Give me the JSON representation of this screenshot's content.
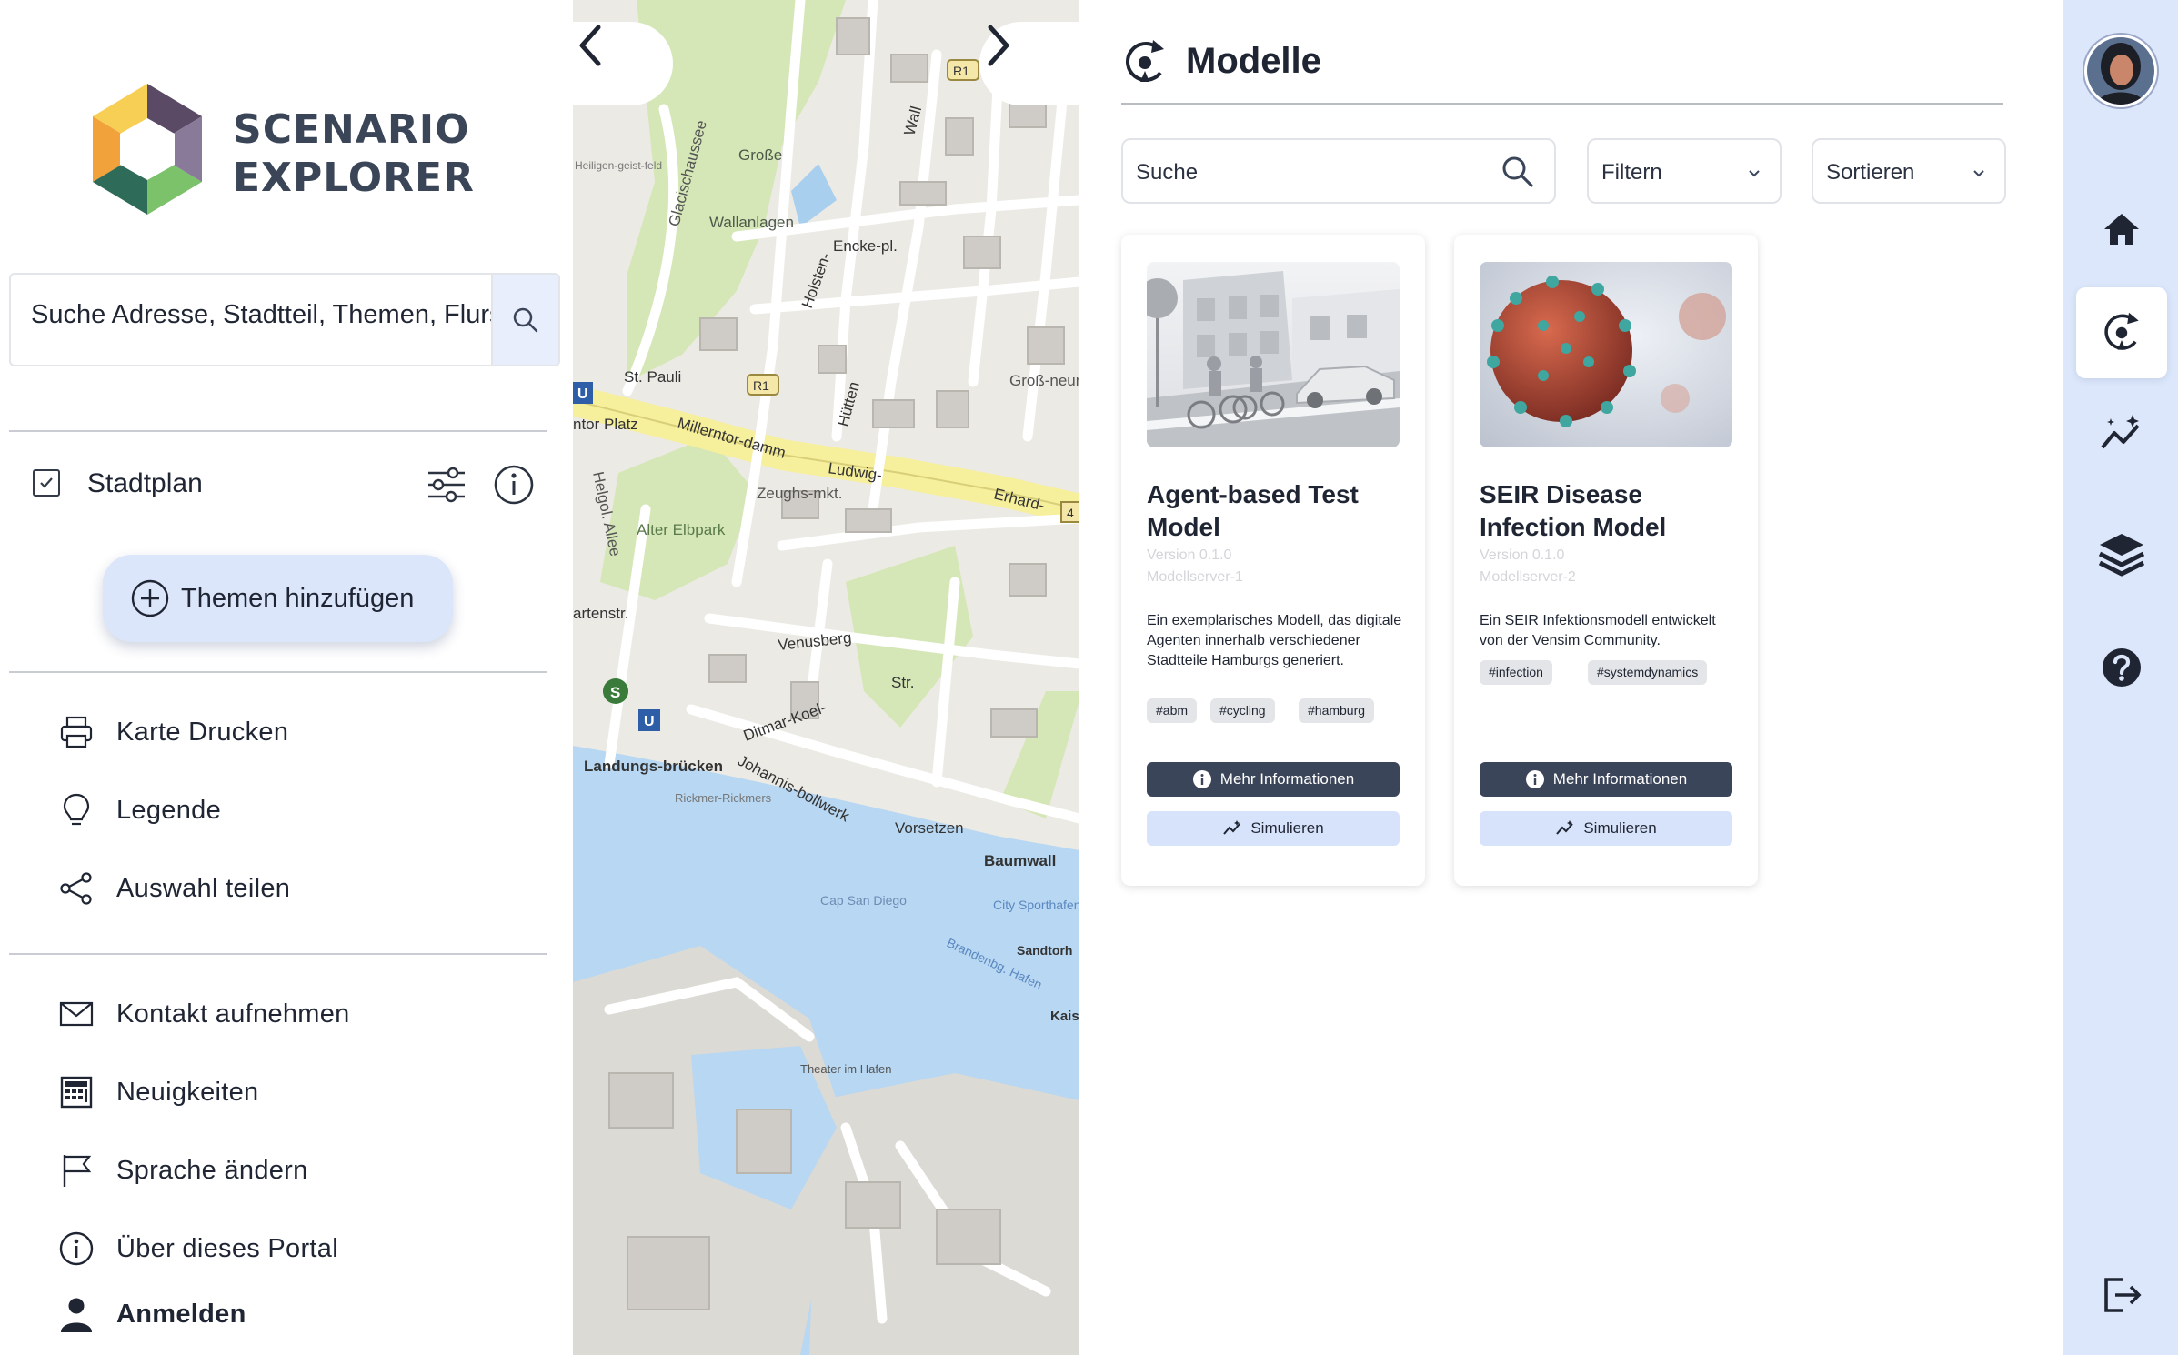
{
  "sidebar": {
    "logo_line1": "SCENARIO",
    "logo_line2": "EXPLORER",
    "search_value": "Suche Adresse, Stadtteil, Themen, Flurs",
    "layer": {
      "label": "Stadtplan",
      "checked": true
    },
    "add_topics_label": "Themen hinzufügen",
    "actions": [
      {
        "label": "Karte Drucken",
        "icon": "printer-icon"
      },
      {
        "label": "Legende",
        "icon": "lightbulb-icon"
      },
      {
        "label": "Auswahl teilen",
        "icon": "share-icon"
      }
    ],
    "links": [
      {
        "label": "Kontakt aufnehmen",
        "icon": "envelope-icon"
      },
      {
        "label": "Neuigkeiten",
        "icon": "newspaper-icon"
      },
      {
        "label": "Sprache ändern",
        "icon": "flag-icon"
      },
      {
        "label": "Über dieses Portal",
        "icon": "info-icon"
      },
      {
        "label": "Anmelden",
        "icon": "user-icon"
      }
    ]
  },
  "map": {
    "labels": [
      "Große",
      "Wallanlagen",
      "Glacischaussee",
      "Heiligen-geist-feld",
      "St. Pauli",
      "Millerntor-damm",
      "Ludwig-",
      "Erhard-",
      "Zeughs-mkt.",
      "Alter Elbpark",
      "Helgol. Allee",
      "Venusberg",
      "Landungs-brücken",
      "Ditmar-Koel-",
      "Johannis-bollwerk",
      "Vorsetzen",
      "Baumwall",
      "Groß-neumarkt",
      "Holsten-",
      "Hütten",
      "Encke-pl.",
      "Rickmer-Rickmers",
      "Cap San Diego",
      "Sandtorh",
      "Theater im Hafen",
      "City Sporthafen",
      "Brandenbg. Hafen",
      "Kais",
      "ntor Platz",
      "artenstr.",
      "Str.",
      "Wall",
      "R1",
      "U",
      "S",
      "4"
    ]
  },
  "main": {
    "title": "Modelle",
    "search_placeholder": "Suche",
    "filter_label": "Filtern",
    "sort_label": "Sortieren",
    "cards": [
      {
        "title": "Agent-based Test Model",
        "version": "Version 0.1.0",
        "server": "Modellserver-1",
        "description": "Ein exemplarisches Modell, das digitale Agenten innerhalb verschiedener Stadtteile Hamburgs generiert.",
        "tags": [
          "#abm",
          "#cycling",
          "#hamburg"
        ],
        "info_label": "Mehr Informationen",
        "simulate_label": "Simulieren",
        "image": "cyclists-street-image"
      },
      {
        "title": "SEIR Disease Infection Model",
        "version": "Version 0.1.0",
        "server": "Modellserver-2",
        "description": "Ein SEIR Infektionsmodell entwickelt von der Vensim Community.",
        "tags": [
          "#infection",
          "#systemdynamics"
        ],
        "info_label": "Mehr Informationen",
        "simulate_label": "Simulieren",
        "image": "virus-image"
      }
    ]
  },
  "rail": {
    "items": [
      "home-icon",
      "models-icon",
      "analysis-icon",
      "layers-icon",
      "help-icon",
      "logout-icon"
    ],
    "active": "models-icon"
  },
  "colors": {
    "accent_light": "#dce7fb",
    "button_dark": "#3b4559",
    "button_light": "#d7e3fa",
    "text": "#1f2533"
  }
}
